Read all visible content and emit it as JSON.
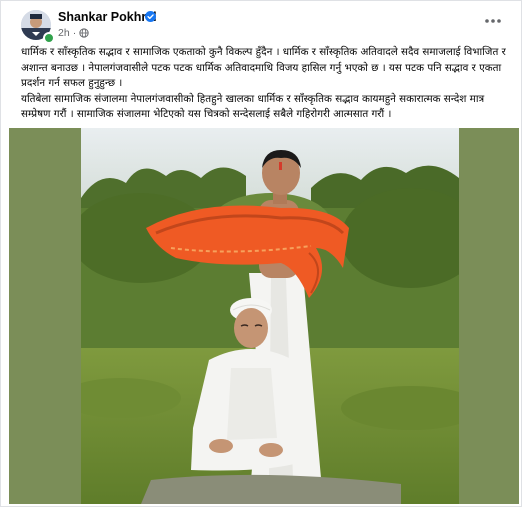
{
  "post": {
    "author": "Shankar Pokhrel",
    "timestamp": "2h",
    "paragraph_1": "धार्मिक र साँस्कृतिक सद्भाव र सामाजिक एकताको कुनै विकल्प हुँदैन । धार्मिक र साँस्कृतिक अतिवादले सदैव समाजलाई विभाजित र अशान्त बनाउछ । नेपालगंजवासीले पटक पटक धार्मिक अतिवादमाथि विजय हासिल गर्नु भएको छ । यस पटक पनि सद्भाव र एकता प्रदर्शन गर्न सफल हुनुहुन्छ ।",
    "paragraph_2": "यतिबेला सामाजिक संजालमा नेपालगंजवासीको हितहुने खालका धार्मिक र साँस्कृतिक सद्भाव कायमहुने सकारात्मक सन्देश मात्र सम्प्रेषण गरौं । सामाजिक संजालमा भेटिएको यस चित्रको सन्देसलाई सबैले गहिरोगरी आत्मसात गरौं ।",
    "audience_icon": "globe-icon",
    "verified_icon": "verified-badge-icon",
    "more_icon": "more-options-icon"
  },
  "colors": {
    "verified_blue": "#1877f2",
    "meta_gray": "#65676b",
    "media_background": "#7b8e58",
    "scarf_orange": "#ef5a24",
    "garment_white": "#f4f4f2"
  }
}
